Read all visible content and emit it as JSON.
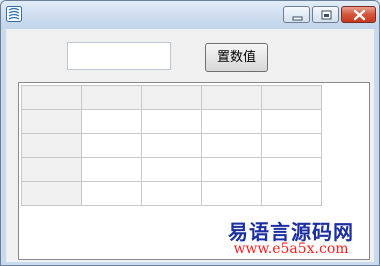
{
  "window": {
    "title": ""
  },
  "controls": {
    "minimize": "minimize",
    "maximize": "maximize",
    "close": "close"
  },
  "form": {
    "input_value": "",
    "button_label": "置数值"
  },
  "grid": {
    "columns": 5,
    "rows": 5,
    "fixed_rows": 1,
    "fixed_cols": 1,
    "cells": [
      [
        "",
        "",
        "",
        "",
        ""
      ],
      [
        "",
        "",
        "",
        "",
        ""
      ],
      [
        "",
        "",
        "",
        "",
        ""
      ],
      [
        "",
        "",
        "",
        "",
        ""
      ],
      [
        "",
        "",
        "",
        "",
        ""
      ]
    ]
  },
  "watermark": {
    "site_name": "易语言源码网",
    "url": "www.e5a5x.com"
  },
  "colors": {
    "titlebar": "#cddcee",
    "close_button": "#c43a21",
    "watermark_text": "#1c2fa0",
    "watermark_url": "#ff1f1f"
  }
}
